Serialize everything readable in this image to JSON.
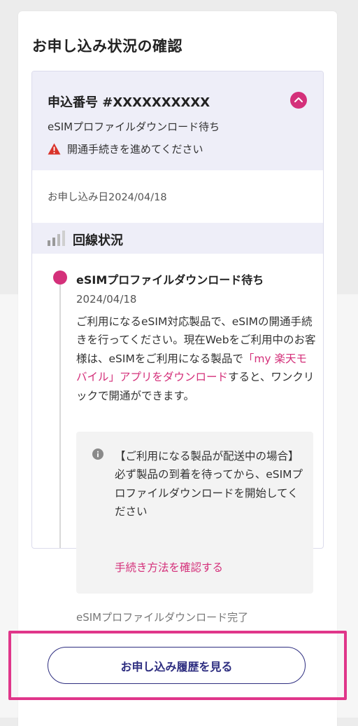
{
  "page": {
    "title": "お申し込み状況の確認"
  },
  "order": {
    "number": "申込番号 #XXXXXXXXXX",
    "status": "eSIMプロファイルダウンロード待ち",
    "warning": "開通手続きを進めてください",
    "apply_date": "お申し込み日2024/04/18"
  },
  "line_status": {
    "title": "回線状況",
    "steps": [
      {
        "title": "eSIMプロファイルダウンロード待ち",
        "date": "2024/04/18",
        "desc_1": "ご利用になるeSIM対応製品で、eSIMの開通手続きを行ってください。現在Webをご利用中のお客様は、eSIMをご利用になる製品で",
        "desc_link": "「my 楽天モバイル」アプリをダウンロード",
        "desc_2": "すると、ワンクリックで開通ができます。",
        "notice": {
          "text": "【ご利用になる製品が配送中の場合】\n必ず製品の到着を待ってから、eSIMプロファイルダウンロードを開始してください",
          "link": "手続き方法を確認する"
        }
      },
      {
        "title": "eSIMプロファイルダウンロード完了"
      }
    ]
  },
  "buttons": {
    "history": "お申し込み履歴を見る"
  },
  "colors": {
    "accent": "#d4307a",
    "navy": "#2e2e80",
    "header_bg": "#eeeef8",
    "highlight": "#e0368a",
    "warning": "#d9332b"
  },
  "icons": {
    "collapse": "chevron-up-icon",
    "warning": "warning-triangle-icon",
    "signal": "signal-bars-icon",
    "info": "info-icon"
  }
}
